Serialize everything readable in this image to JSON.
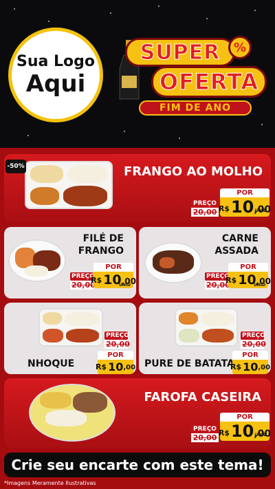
{
  "header": {
    "logo_line1": "Sua Logo",
    "logo_line2": "Aqui",
    "super": "SUPER",
    "percent_symbol": "%",
    "oferta": "OFERTA",
    "fim_de_ano": "FIM DE ANO"
  },
  "discount_badge": "-50%",
  "labels": {
    "preco": "PREÇO",
    "por": "POR",
    "currency": "R$",
    "unid": "UNID"
  },
  "products": [
    {
      "name_line1": "FRANGO AO MOLHO",
      "name_line2": "",
      "old_price": "20,00",
      "price_int": "10",
      "price_cents": ",00"
    },
    {
      "name_line1": "FILÉ DE",
      "name_line2": "FRANGO",
      "old_price": "20,00",
      "price_int": "10",
      "price_cents": ",00"
    },
    {
      "name_line1": "CARNE",
      "name_line2": "ASSADA",
      "old_price": "20,00",
      "price_int": "10",
      "price_cents": ",00"
    },
    {
      "name_line1": "NHOQUE",
      "name_line2": "",
      "old_price": "20,00",
      "price_int": "10",
      "price_cents": ",00"
    },
    {
      "name_line1": "PURE DE BATATA",
      "name_line2": "",
      "old_price": "20,00",
      "price_int": "10",
      "price_cents": ",00"
    },
    {
      "name_line1": "FAROFA CASEIRA",
      "name_line2": "",
      "old_price": "20,00",
      "price_int": "10",
      "price_cents": ",00"
    }
  ],
  "cta": "Crie seu encarte com este tema!",
  "footnote": "*Imagens Meramente Ilustrativas",
  "colors": {
    "red": "#d61a1e",
    "yellow": "#f6c112",
    "dark": "#0b0b0e"
  }
}
